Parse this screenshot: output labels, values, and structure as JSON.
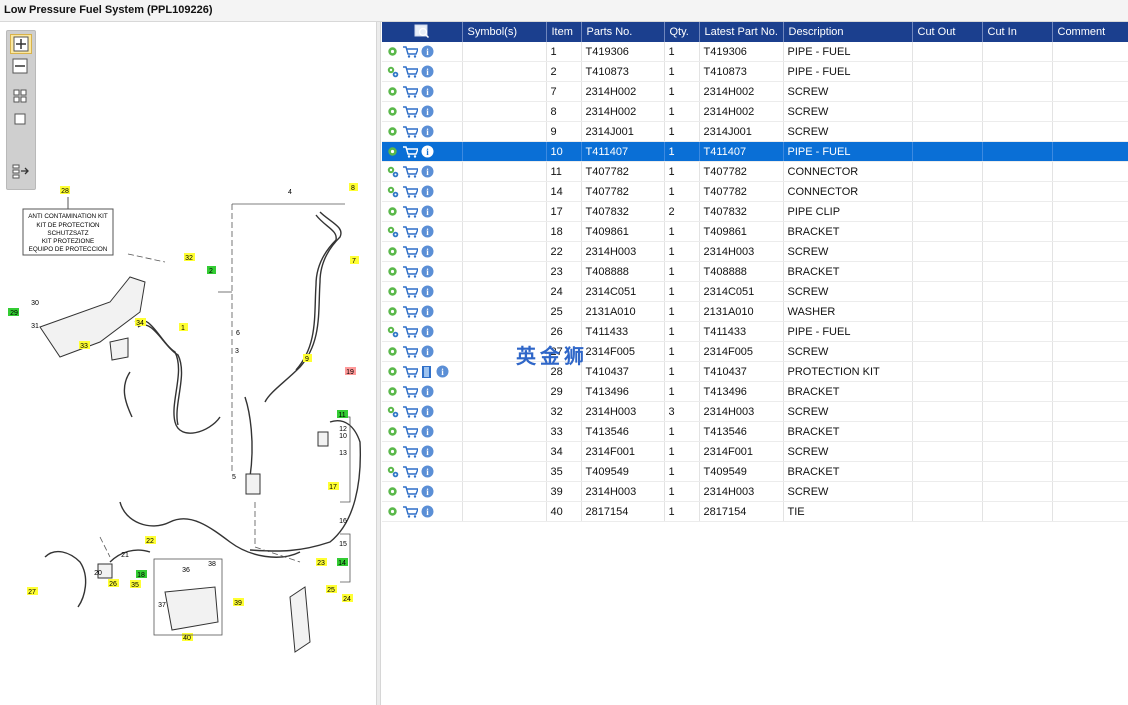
{
  "window": {
    "title": "Low Pressure Fuel System (PPL109226)"
  },
  "toolbar": {
    "items": [
      "zoom-in",
      "zoom-out",
      "fit-all",
      "fit-window",
      "show-list"
    ]
  },
  "colors": {
    "header_bg": "#1b3f8e",
    "selected_row": "#0a6fd6",
    "callout_yellow": "#ffff33",
    "callout_green": "#33cc33",
    "callout_red": "#ff9999"
  },
  "diagram": {
    "kit_box_lines": [
      "ANTI CONTAMINATION KIT",
      "KIT DE PROTECTION",
      "SCHUTZSATZ",
      "KIT PROTEZIONE",
      "EQUIPO DE PROTECCION"
    ],
    "callouts": [
      "28",
      "32",
      "2",
      "8",
      "4",
      "7",
      "30",
      "31",
      "29",
      "34",
      "1",
      "33",
      "6",
      "3",
      "9",
      "19",
      "11",
      "12",
      "10",
      "13",
      "5",
      "17",
      "22",
      "16",
      "15",
      "14",
      "23",
      "26",
      "20",
      "21",
      "18",
      "27",
      "36",
      "38",
      "35",
      "37",
      "39",
      "25",
      "24",
      "40"
    ]
  },
  "table": {
    "columns": [
      "",
      "Symbol(s)",
      "Item",
      "Parts No.",
      "Qty.",
      "Latest Part No.",
      "Description",
      "Cut Out",
      "Cut In",
      "Comment"
    ],
    "rows": [
      {
        "item": "1",
        "part": "T419306",
        "qty": "1",
        "latest": "T419306",
        "desc": "PIPE - FUEL",
        "info": "i"
      },
      {
        "item": "2",
        "part": "T410873",
        "qty": "1",
        "latest": "T410873",
        "desc": "PIPE - FUEL",
        "info": "i"
      },
      {
        "item": "7",
        "part": "2314H002",
        "qty": "1",
        "latest": "2314H002",
        "desc": "SCREW",
        "info": "i"
      },
      {
        "item": "8",
        "part": "2314H002",
        "qty": "1",
        "latest": "2314H002",
        "desc": "SCREW",
        "info": "i"
      },
      {
        "item": "9",
        "part": "2314J001",
        "qty": "1",
        "latest": "2314J001",
        "desc": "SCREW",
        "info": "i"
      },
      {
        "item": "10",
        "part": "T411407",
        "qty": "1",
        "latest": "T411407",
        "desc": "PIPE - FUEL",
        "info": "i"
      },
      {
        "item": "11",
        "part": "T407782",
        "qty": "1",
        "latest": "T407782",
        "desc": "CONNECTOR",
        "info": "i"
      },
      {
        "item": "14",
        "part": "T407782",
        "qty": "1",
        "latest": "T407782",
        "desc": "CONNECTOR",
        "info": "i"
      },
      {
        "item": "17",
        "part": "T407832",
        "qty": "2",
        "latest": "T407832",
        "desc": "PIPE CLIP",
        "info": "i"
      },
      {
        "item": "18",
        "part": "T409861",
        "qty": "1",
        "latest": "T409861",
        "desc": "BRACKET",
        "info": "i"
      },
      {
        "item": "22",
        "part": "2314H003",
        "qty": "1",
        "latest": "2314H003",
        "desc": "SCREW",
        "info": "i"
      },
      {
        "item": "23",
        "part": "T408888",
        "qty": "1",
        "latest": "T408888",
        "desc": "BRACKET",
        "info": "i"
      },
      {
        "item": "24",
        "part": "2314C051",
        "qty": "1",
        "latest": "2314C051",
        "desc": "SCREW",
        "info": "i"
      },
      {
        "item": "25",
        "part": "2131A010",
        "qty": "1",
        "latest": "2131A010",
        "desc": "WASHER",
        "info": "i"
      },
      {
        "item": "26",
        "part": "T411433",
        "qty": "1",
        "latest": "T411433",
        "desc": "PIPE - FUEL",
        "info": "i"
      },
      {
        "item": "27",
        "part": "2314F005",
        "qty": "1",
        "latest": "2314F005",
        "desc": "SCREW",
        "info": "i"
      },
      {
        "item": "28",
        "part": "T410437",
        "qty": "1",
        "latest": "T410437",
        "desc": "PROTECTION KIT",
        "info": "i"
      },
      {
        "item": "29",
        "part": "T413496",
        "qty": "1",
        "latest": "T413496",
        "desc": "BRACKET",
        "info": "i"
      },
      {
        "item": "32",
        "part": "2314H003",
        "qty": "3",
        "latest": "2314H003",
        "desc": "SCREW",
        "info": "i"
      },
      {
        "item": "33",
        "part": "T413546",
        "qty": "1",
        "latest": "T413546",
        "desc": "BRACKET",
        "info": "i"
      },
      {
        "item": "34",
        "part": "2314F001",
        "qty": "1",
        "latest": "2314F001",
        "desc": "SCREW",
        "info": "i"
      },
      {
        "item": "35",
        "part": "T409549",
        "qty": "1",
        "latest": "T409549",
        "desc": "BRACKET",
        "info": "i"
      },
      {
        "item": "39",
        "part": "2314H003",
        "qty": "1",
        "latest": "2314H003",
        "desc": "SCREW",
        "info": "i"
      },
      {
        "item": "40",
        "part": "2817154",
        "qty": "1",
        "latest": "2817154",
        "desc": "TIE",
        "info": "i"
      }
    ]
  },
  "watermark": "英金狮"
}
